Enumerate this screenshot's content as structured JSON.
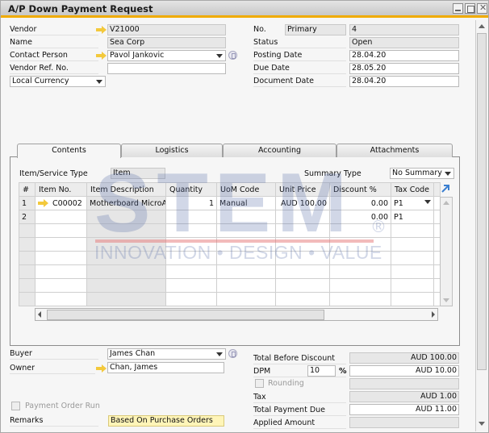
{
  "window": {
    "title": "A/P Down Payment Request",
    "controls": [
      "minimize",
      "maximize",
      "close"
    ]
  },
  "header_left": {
    "vendor_label": "Vendor",
    "vendor_value": "V21000",
    "name_label": "Name",
    "name_value": "Sea Corp",
    "contact_label": "Contact Person",
    "contact_value": "Pavol Jankovic",
    "vendor_ref_label": "Vendor Ref. No.",
    "vendor_ref_value": "",
    "currency_value": "Local Currency"
  },
  "header_right": {
    "no_label": "No.",
    "series_value": "Primary",
    "no_value": "4",
    "status_label": "Status",
    "status_value": "Open",
    "posting_date_label": "Posting Date",
    "posting_date_value": "28.04.20",
    "due_date_label": "Due Date",
    "due_date_value": "28.05.20",
    "document_date_label": "Document Date",
    "document_date_value": "28.04.20"
  },
  "tabs": [
    {
      "label": "Contents",
      "active": true
    },
    {
      "label": "Logistics",
      "active": false
    },
    {
      "label": "Accounting",
      "active": false
    },
    {
      "label": "Attachments",
      "active": false
    }
  ],
  "contents": {
    "item_service_type_label": "Item/Service Type",
    "item_service_type_value": "Item",
    "summary_type_label": "Summary Type",
    "summary_type_value": "No Summary",
    "columns": [
      "#",
      "Item No.",
      "Item Description",
      "Quantity",
      "UoM Code",
      "Unit Price",
      "Discount %",
      "Tax Code",
      ""
    ],
    "rows": [
      {
        "num": "1",
        "item_no": "C00002",
        "description": "Motherboard MicroAT",
        "quantity": "1",
        "uom": "Manual",
        "unit_price": "AUD 100.00",
        "discount": "0.00",
        "tax_code": "P1"
      },
      {
        "num": "2",
        "item_no": "",
        "description": "",
        "quantity": "",
        "uom": "",
        "unit_price": "",
        "discount": "0.00",
        "tax_code": "P1"
      },
      {
        "num": "",
        "item_no": "",
        "description": "",
        "quantity": "",
        "uom": "",
        "unit_price": "",
        "discount": "",
        "tax_code": ""
      },
      {
        "num": "",
        "item_no": "",
        "description": "",
        "quantity": "",
        "uom": "",
        "unit_price": "",
        "discount": "",
        "tax_code": ""
      },
      {
        "num": "",
        "item_no": "",
        "description": "",
        "quantity": "",
        "uom": "",
        "unit_price": "",
        "discount": "",
        "tax_code": ""
      },
      {
        "num": "",
        "item_no": "",
        "description": "",
        "quantity": "",
        "uom": "",
        "unit_price": "",
        "discount": "",
        "tax_code": ""
      },
      {
        "num": "",
        "item_no": "",
        "description": "",
        "quantity": "",
        "uom": "",
        "unit_price": "",
        "discount": "",
        "tax_code": ""
      },
      {
        "num": "",
        "item_no": "",
        "description": "",
        "quantity": "",
        "uom": "",
        "unit_price": "",
        "discount": "",
        "tax_code": ""
      }
    ]
  },
  "footer_left": {
    "buyer_label": "Buyer",
    "buyer_value": "James Chan",
    "owner_label": "Owner",
    "owner_value": "Chan, James",
    "payment_order_run_label": "Payment Order Run",
    "remarks_label": "Remarks",
    "remarks_value": "Based On Purchase Orders"
  },
  "footer_right": {
    "total_before_discount_label": "Total Before Discount",
    "total_before_discount_value": "AUD 100.00",
    "dpm_label": "DPM",
    "dpm_percent_value": "10",
    "dpm_percent_sign": "%",
    "dpm_amount_value": "AUD 10.00",
    "rounding_label": "Rounding",
    "rounding_value": "",
    "tax_label": "Tax",
    "tax_value": "AUD 1.00",
    "total_payment_due_label": "Total Payment Due",
    "total_payment_due_value": "AUD 11.00",
    "applied_amount_label": "Applied Amount",
    "applied_amount_value": ""
  },
  "watermark": {
    "brand": "STEM",
    "tagline": "INNOVATION • DESIGN • VALUE",
    "registered": "®"
  }
}
